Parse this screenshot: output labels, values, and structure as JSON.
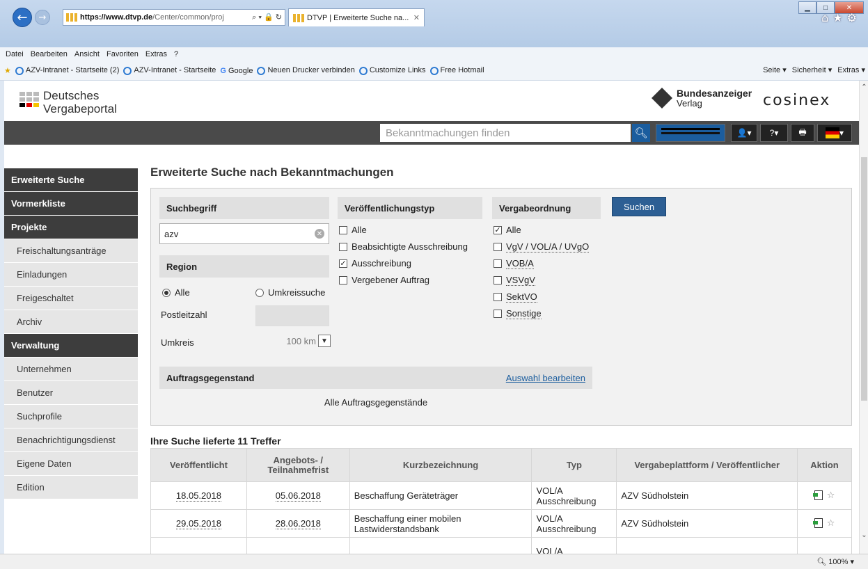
{
  "browser": {
    "address_domain": "https://www.dtvp.de",
    "address_rest": "/Center/common/proj",
    "address_tools": "⌕ ▾ 🔒 ↻",
    "tab_title": "DTVP | Erweiterte Suche na...",
    "menu": [
      "Datei",
      "Bearbeiten",
      "Ansicht",
      "Favoriten",
      "Extras",
      "?"
    ],
    "favorites": [
      "AZV-Intranet - Startseite (2)",
      "AZV-Intranet - Startseite",
      "Google",
      "Neuen Drucker verbinden",
      "Customize Links",
      "Free Hotmail"
    ],
    "favbar_right": [
      "Seite ▾",
      "Sicherheit ▾",
      "Extras ▾"
    ],
    "zoom": "100%"
  },
  "header": {
    "logo_line1": "Deutsches",
    "logo_line2": "Vergabeportal",
    "ba_line1": "Bundesanzeiger",
    "ba_line2": "Verlag",
    "cosinex": "cosinex",
    "search_placeholder": "Bekanntmachungen finden"
  },
  "sidebar": {
    "items": [
      {
        "label": "Erweiterte Suche",
        "type": "head"
      },
      {
        "label": "Vormerkliste",
        "type": "head"
      },
      {
        "label": "Projekte",
        "type": "head"
      },
      {
        "label": "Freischaltungsanträge",
        "type": "item"
      },
      {
        "label": "Einladungen",
        "type": "item"
      },
      {
        "label": "Freigeschaltet",
        "type": "item"
      },
      {
        "label": "Archiv",
        "type": "item"
      },
      {
        "label": "Verwaltung",
        "type": "head"
      },
      {
        "label": "Unternehmen",
        "type": "item"
      },
      {
        "label": "Benutzer",
        "type": "item"
      },
      {
        "label": "Suchprofile",
        "type": "item"
      },
      {
        "label": "Benachrichtigungsdienst",
        "type": "item"
      },
      {
        "label": "Eigene Daten",
        "type": "item"
      },
      {
        "label": "Edition",
        "type": "item"
      }
    ]
  },
  "main": {
    "title": "Erweiterte Suche nach Bekanntmachungen",
    "suchbegriff_label": "Suchbegriff",
    "suchbegriff_value": "azv",
    "typ_label": "Veröffentlichungstyp",
    "ordnung_label": "Vergabeordnung",
    "submit": "Suchen",
    "region_label": "Region",
    "radio_alle": "Alle",
    "radio_umkreis": "Umkreissuche",
    "plz_label": "Postleitzahl",
    "umkreis_label": "Umkreis",
    "umkreis_value": "100 km",
    "typ_options": [
      {
        "label": "Alle",
        "checked": false
      },
      {
        "label": "Beabsichtigte Ausschreibung",
        "checked": false
      },
      {
        "label": "Ausschreibung",
        "checked": true
      },
      {
        "label": "Vergebener Auftrag",
        "checked": false
      }
    ],
    "ordnung_options": [
      {
        "label": "Alle",
        "checked": true
      },
      {
        "label": "VgV / VOL/A / UVgO",
        "checked": false
      },
      {
        "label": "VOB/A",
        "checked": false
      },
      {
        "label": "VSVgV",
        "checked": false
      },
      {
        "label": "SektVO",
        "checked": false
      },
      {
        "label": "Sonstige",
        "checked": false
      }
    ],
    "gegenstand_label": "Auftragsgegenstand",
    "gegenstand_edit": "Auswahl bearbeiten",
    "gegenstand_value": "Alle Auftragsgegenstände"
  },
  "results": {
    "title": "Ihre Suche lieferte 11 Treffer",
    "columns": [
      "Veröffentlicht",
      "Angebots- / Teilnahmefrist",
      "Kurzbezeichnung",
      "Typ",
      "Vergabeplattform / Veröffentlicher",
      "Aktion"
    ],
    "rows": [
      [
        "18.05.2018",
        "05.06.2018",
        "Beschaffung Geräteträger",
        "VOL/A Ausschreibung",
        "AZV Südholstein"
      ],
      [
        "29.05.2018",
        "28.06.2018",
        "Beschaffung einer mobilen Lastwiderstandsbank",
        "VOL/A Ausschreibung",
        "AZV Südholstein"
      ],
      [
        "",
        "",
        "",
        "VOL/A",
        ""
      ]
    ]
  }
}
